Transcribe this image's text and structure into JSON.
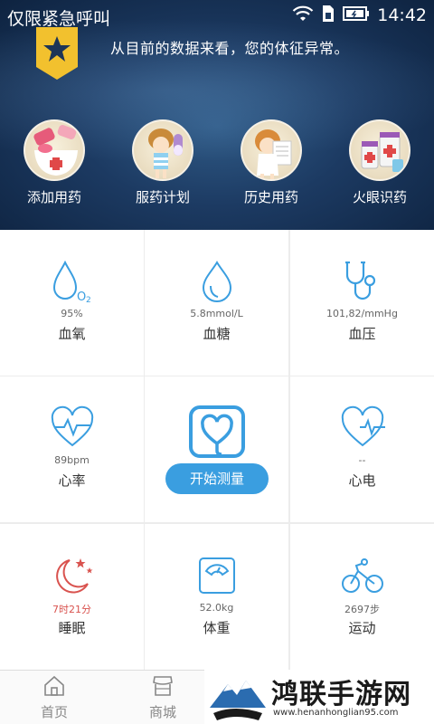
{
  "statusbar": {
    "carrier": "仅限紧急呼叫",
    "time": "14:42"
  },
  "header": {
    "alert": "从目前的数据来看，您的体征异常。"
  },
  "features": [
    {
      "label": "添加用药",
      "icon": "add-medicine-icon"
    },
    {
      "label": "服药计划",
      "icon": "medication-plan-icon"
    },
    {
      "label": "历史用药",
      "icon": "medication-history-icon"
    },
    {
      "label": "火眼识药",
      "icon": "identify-medicine-icon"
    }
  ],
  "metrics": {
    "oxygen": {
      "value": "95%",
      "name": "血氧",
      "icon": "blood-oxygen-icon"
    },
    "sugar": {
      "value": "5.8mmol/L",
      "name": "血糖",
      "icon": "blood-sugar-icon"
    },
    "pressure": {
      "value": "101,82/mmHg",
      "name": "血压",
      "icon": "stethoscope-icon"
    },
    "heartrate": {
      "value": "89bpm",
      "name": "心率",
      "icon": "heart-rate-icon"
    },
    "ecg": {
      "value": "--",
      "name": "心电",
      "icon": "ecg-icon"
    },
    "sleep": {
      "value": "7时21分",
      "name": "睡眠",
      "icon": "sleep-moon-icon"
    },
    "weight": {
      "value": "52.0kg",
      "name": "体重",
      "icon": "scale-icon"
    },
    "exercise": {
      "value": "2697步",
      "name": "运动",
      "icon": "bicycle-icon"
    }
  },
  "center": {
    "button": "开始测量",
    "icon": "measure-heart-icon"
  },
  "nav": [
    {
      "label": "首页",
      "icon": "home-icon"
    },
    {
      "label": "商城",
      "icon": "shop-icon"
    }
  ],
  "watermark": {
    "title": "鸿联手游网",
    "url": "www.henanhonglian95.com"
  },
  "colors": {
    "accent": "#3a9ee0",
    "icon_blue": "#3a9ee0",
    "sleep_red": "#d9534f",
    "header_dark": "#0e2340"
  }
}
